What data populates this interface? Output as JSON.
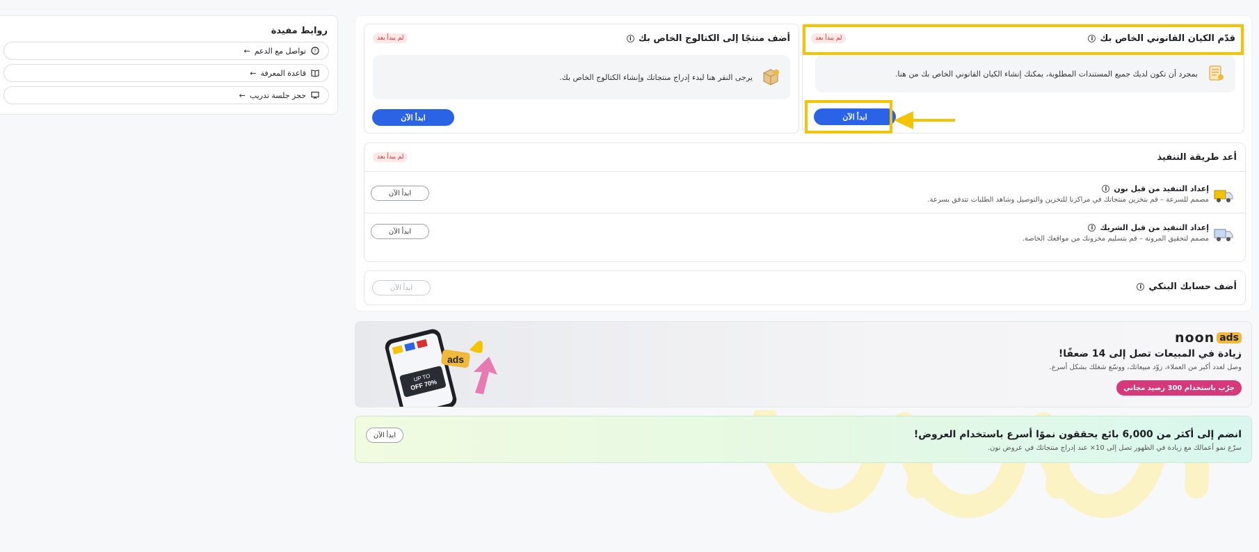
{
  "links": {
    "title": "روابط مفيدة",
    "items": [
      {
        "label": "تواصل مع الدعم",
        "icon": "help-circle-icon"
      },
      {
        "label": "قاعدة المعرفة",
        "icon": "book-icon"
      },
      {
        "label": "حجز جلسة تدريب",
        "icon": "presentation-icon"
      }
    ]
  },
  "legal_card": {
    "title": "قدّم الكيان القانوني الخاص بك",
    "badge": "لم يبدأ بعد",
    "body": "بمجرد أن تكون لديك جميع المستندات المطلوبة، يمكنك إنشاء الكيان القانوني الخاص بك من هنا.",
    "button": "ابدأ الآن"
  },
  "catalog_card": {
    "title": "أضف منتجًا إلى الكتالوج الخاص بك",
    "badge": "لم يبدأ بعد",
    "body": "يرجى النقر هنا لبدء إدراج منتجاتك وإنشاء الكتالوج الخاص بك.",
    "button": "ابدأ الآن"
  },
  "fulfillment": {
    "title": "أعد طريقة التنفيذ",
    "badge": "لم يبدأ بعد",
    "rows": [
      {
        "title": "إعداد التنفيذ من قبل نون",
        "desc": "مصمم للسرعة – قم بتخزين منتجاتك في مراكزنا للتخزين والتوصيل وشاهد الطلبات تتدفق بسرعة.",
        "button": "ابدأ الآن"
      },
      {
        "title": "إعداد التنفيذ من قبل الشريك",
        "desc": "مصمم لتحقيق المرونة – قم بتسليم مخزونك من مواقعك الخاصة.",
        "button": "ابدأ الآن"
      }
    ]
  },
  "bank": {
    "title": "أضف حسابك البنكي",
    "button": "ابدأ الآن"
  },
  "ads_banner": {
    "logo_word": "noon",
    "logo_badge": "ads",
    "headline": "زيادة في المبيعات تصل إلى 14 ضعفًا!",
    "sub": "وصل لعدد أكبر من العملاء، زوّد مبيعاتك، ووسّع شغلك بشكل أسرع.",
    "button": "جرّب باستخدام 300 رصيد مجاني",
    "phone_sticker": "ads",
    "phone_promo": "UP TO 70% OFF",
    "colors": {
      "pink": "#d6397a",
      "yellow": "#f0b93a"
    }
  },
  "promo_banner": {
    "headline": "انضم إلى أكثر من 6,000 بائع يحققون نموًا أسرع باستخدام العروض!",
    "sub": "سرّع نمو أعمالك مع زيادة في الظهور تصل إلى 10× عند إدراج منتجاتك في عروض نون.",
    "button": "ابدأ الآن"
  },
  "colors": {
    "accent": "#2a63e6",
    "highlight": "#f5c400",
    "badge_red": "#d93030"
  }
}
